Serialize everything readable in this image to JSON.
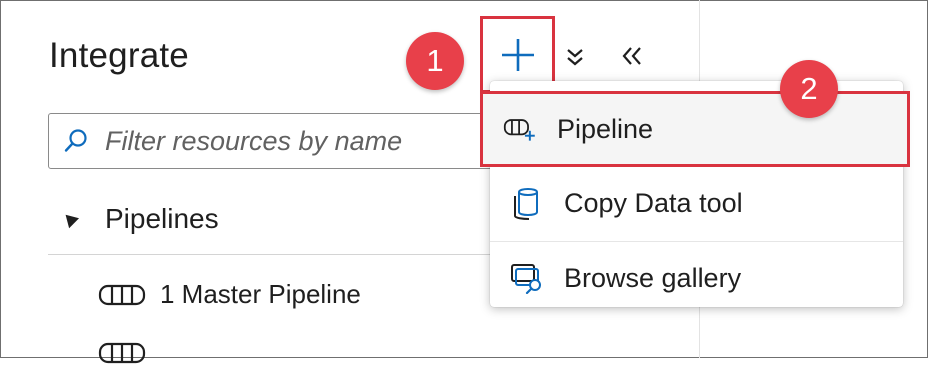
{
  "panel": {
    "title": "Integrate"
  },
  "toolbar": {
    "add_icon": "plus-icon",
    "expand_icon": "expand-all-icon",
    "collapse_icon": "collapse-panel-icon"
  },
  "badges": {
    "step1": "1",
    "step2": "2"
  },
  "search": {
    "placeholder": "Filter resources by name",
    "icon": "search-icon"
  },
  "tree": {
    "section": "Pipelines",
    "items": [
      {
        "label": "1 Master Pipeline",
        "icon": "pipeline-icon"
      },
      {
        "label": "",
        "icon": "pipeline-icon"
      }
    ]
  },
  "menu": {
    "items": [
      {
        "label": "Pipeline",
        "icon": "pipeline-add-icon"
      },
      {
        "label": "Copy Data tool",
        "icon": "copy-data-icon"
      },
      {
        "label": "Browse gallery",
        "icon": "browse-gallery-icon"
      }
    ]
  },
  "colors": {
    "highlight": "#d9333f",
    "badge": "#e8404a",
    "accent": "#0f6cbd"
  }
}
